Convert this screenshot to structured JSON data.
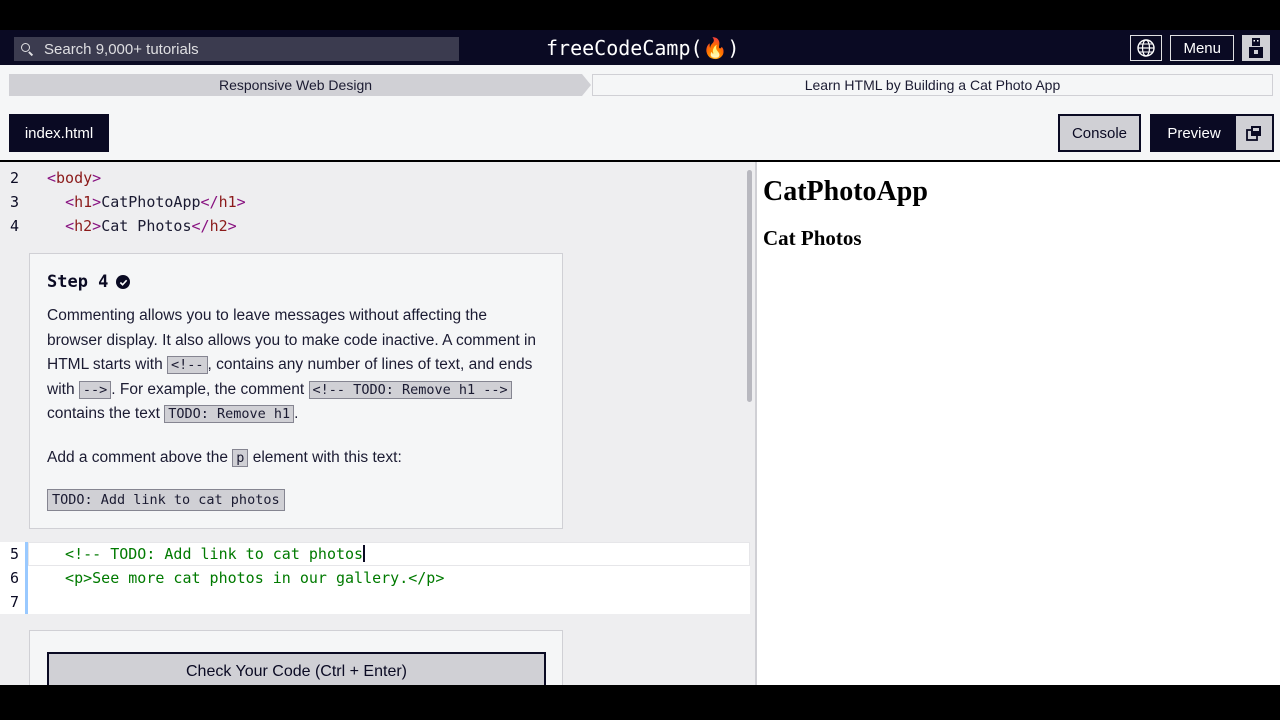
{
  "nav": {
    "search_placeholder": "Search 9,000+ tutorials",
    "brand": "freeCodeCamp(🔥)",
    "menu_label": "Menu"
  },
  "breadcrumb": {
    "superblock": "Responsive Web Design",
    "block": "Learn HTML by Building a Cat Photo App"
  },
  "toolbar": {
    "file_tab": "index.html",
    "console_label": "Console",
    "preview_label": "Preview"
  },
  "editor": {
    "top_lines": [
      {
        "num": "2",
        "indent": "",
        "tag": "body",
        "content": "",
        "close": ""
      },
      {
        "num": "3",
        "indent": "  ",
        "tag": "h1",
        "content": "CatPhotoApp",
        "close": "h1"
      },
      {
        "num": "4",
        "indent": "  ",
        "tag": "h2",
        "content": "Cat Photos",
        "close": "h2"
      }
    ],
    "editable_lines": [
      {
        "num": "5",
        "text": "  <!-- TODO: Add link to cat photos"
      },
      {
        "num": "6",
        "text": "  <p>See more cat photos in our gallery.</p>"
      },
      {
        "num": "7",
        "text": ""
      }
    ]
  },
  "step": {
    "title": "Step 4",
    "p1_a": "Commenting allows you to leave messages without affecting the browser display. It also allows you to make code inactive. A comment in HTML starts with ",
    "p1_code1": "<!--",
    "p1_b": ", contains any number of lines of text, and ends with ",
    "p1_code2": "-->",
    "p1_c": ". For example, the comment ",
    "p1_code3": "<!-- TODO: Remove h1 -->",
    "p1_d": " contains the text ",
    "p1_code4": "TODO: Remove h1",
    "p1_e": ".",
    "p2_a": "Add a comment above the ",
    "p2_code": "p",
    "p2_b": " element with this text:",
    "todo_text": "TODO: Add link to cat photos"
  },
  "check_button": "Check Your Code (Ctrl + Enter)",
  "preview": {
    "h1": "CatPhotoApp",
    "h2": "Cat Photos"
  }
}
